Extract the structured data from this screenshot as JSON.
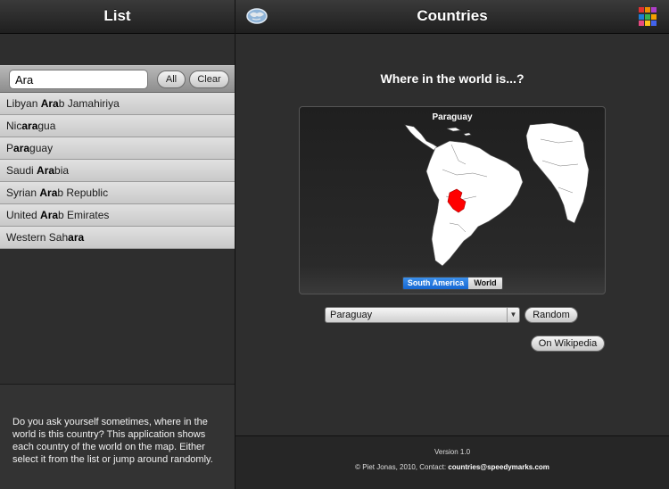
{
  "left": {
    "title": "List",
    "search": {
      "value": "Ara"
    },
    "buttons": {
      "all": "All",
      "clear": "Clear"
    },
    "items": [
      {
        "before": "Libyan ",
        "match": "Ara",
        "after": "b Jamahiriya"
      },
      {
        "before": "Nic",
        "match": "ara",
        "after": "gua"
      },
      {
        "before": "P",
        "match": "ara",
        "after": "guay"
      },
      {
        "before": "Saudi ",
        "match": "Ara",
        "after": "bia"
      },
      {
        "before": "Syrian ",
        "match": "Ara",
        "after": "b Republic"
      },
      {
        "before": "United ",
        "match": "Ara",
        "after": "b Emirates"
      },
      {
        "before": "Western Sah",
        "match": "ara",
        "after": ""
      }
    ],
    "description": "Do you ask yourself sometimes, where in the world is this country? This application shows each country of the world on the map. Either select it from the list or jump around randomly."
  },
  "right": {
    "title": "Countries",
    "question": "Where in the world is...?",
    "map": {
      "country_label": "Paraguay",
      "highlight_color": "#ff0000",
      "segments": {
        "south_america": "South America",
        "world": "World"
      },
      "selected_segment": "South America"
    },
    "select": {
      "value": "Paraguay"
    },
    "buttons": {
      "random": "Random",
      "wikipedia": "On Wikipedia"
    },
    "footer": {
      "version": "Version 1.0",
      "credits_prefix": "© Piet Jonas, 2010, Contact: ",
      "email": "countries@speedymarks.com"
    }
  },
  "icons": [
    "globe-icon",
    "color-grid-icon",
    "dropdown-arrow-icon"
  ],
  "colors": {
    "accent": "#1667d3",
    "highlight": "#ff0000"
  }
}
